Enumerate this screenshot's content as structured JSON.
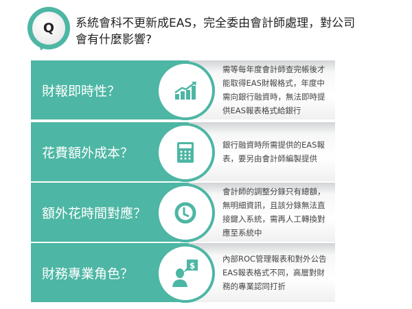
{
  "question": {
    "badge": "Q",
    "text": "系統會科不更新成EAS，完全委由會計師處理，對公司會有什麼影響?"
  },
  "colors": {
    "accent": "#4db6a4"
  },
  "rows": [
    {
      "title": "財報即時性？",
      "icon": "growth-chart-icon",
      "desc": "需等每年度會計師查完帳後才能取得EAS財報格式，年度中需向銀行融資時，無法即時提供EAS報表格式給銀行"
    },
    {
      "title": "花費額外成本？",
      "icon": "calculator-icon",
      "desc": "銀行融資時所需提供的EAS報表，要另由會計師編製提供"
    },
    {
      "title": "額外花時間對應？",
      "icon": "clock-icon",
      "desc": "會計師的調整分錄只有總額，無明細資訊，且該分錄無法直接鍵入系統，需再人工轉換對應至系統中"
    },
    {
      "title": "財務專業角色？",
      "icon": "person-dollar-icon",
      "desc": "內部ROC管理報表和對外公告EAS報表格式不同，高層對財務的專業認同打折"
    }
  ]
}
